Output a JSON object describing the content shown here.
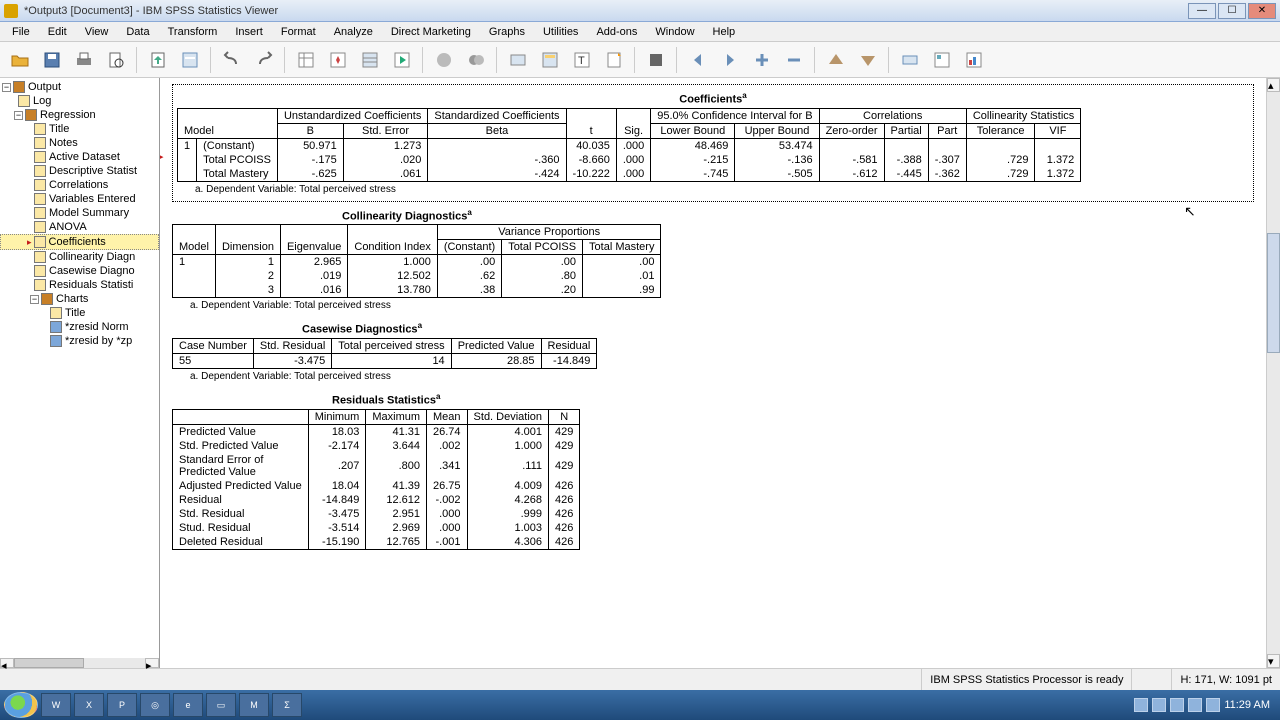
{
  "window": {
    "title": "*Output3 [Document3] - IBM SPSS Statistics Viewer"
  },
  "menu": [
    "File",
    "Edit",
    "View",
    "Data",
    "Transform",
    "Insert",
    "Format",
    "Analyze",
    "Direct Marketing",
    "Graphs",
    "Utilities",
    "Add-ons",
    "Window",
    "Help"
  ],
  "outline": {
    "root": "Output",
    "log": "Log",
    "regression": "Regression",
    "items": [
      "Title",
      "Notes",
      "Active Dataset",
      "Descriptive Statist",
      "Correlations",
      "Variables Entered",
      "Model Summary",
      "ANOVA",
      "Coefficients",
      "Collinearity Diagn",
      "Casewise Diagno",
      "Residuals Statisti"
    ],
    "selected_index": 8,
    "charts": "Charts",
    "chart_items": [
      "Title",
      "*zresid Norm",
      "*zresid by *zp"
    ]
  },
  "tables": {
    "coefficients": {
      "title": "Coefficients",
      "group_headers": [
        "Unstandardized Coefficients",
        "Standardized Coefficients",
        "",
        "",
        "95.0% Confidence Interval for B",
        "Correlations",
        "Collinearity Statistics"
      ],
      "cols": [
        "Model",
        "",
        "B",
        "Std. Error",
        "Beta",
        "t",
        "Sig.",
        "Lower Bound",
        "Upper Bound",
        "Zero-order",
        "Partial",
        "Part",
        "Tolerance",
        "VIF"
      ],
      "rows": [
        [
          "1",
          "(Constant)",
          "50.971",
          "1.273",
          "",
          "40.035",
          ".000",
          "48.469",
          "53.474",
          "",
          "",
          "",
          "",
          ""
        ],
        [
          "",
          "Total PCOISS",
          "-.175",
          ".020",
          "-.360",
          "-8.660",
          ".000",
          "-.215",
          "-.136",
          "-.581",
          "-.388",
          "-.307",
          ".729",
          "1.372"
        ],
        [
          "",
          "Total Mastery",
          "-.625",
          ".061",
          "-.424",
          "-10.222",
          ".000",
          "-.745",
          "-.505",
          "-.612",
          "-.445",
          "-.362",
          ".729",
          "1.372"
        ]
      ],
      "footnote": "a. Dependent Variable: Total perceived stress"
    },
    "collinearity": {
      "title": "Collinearity Diagnostics",
      "group_header": "Variance Proportions",
      "cols": [
        "Model",
        "Dimension",
        "Eigenvalue",
        "Condition Index",
        "(Constant)",
        "Total PCOISS",
        "Total Mastery"
      ],
      "rows": [
        [
          "1",
          "1",
          "2.965",
          "1.000",
          ".00",
          ".00",
          ".00"
        ],
        [
          "",
          "2",
          ".019",
          "12.502",
          ".62",
          ".80",
          ".01"
        ],
        [
          "",
          "3",
          ".016",
          "13.780",
          ".38",
          ".20",
          ".99"
        ]
      ],
      "footnote": "a. Dependent Variable: Total perceived stress"
    },
    "casewise": {
      "title": "Casewise Diagnostics",
      "cols": [
        "Case Number",
        "Std. Residual",
        "Total perceived stress",
        "Predicted Value",
        "Residual"
      ],
      "rows": [
        [
          "55",
          "-3.475",
          "14",
          "28.85",
          "-14.849"
        ]
      ],
      "footnote": "a. Dependent Variable: Total perceived stress"
    },
    "residuals": {
      "title": "Residuals Statistics",
      "cols": [
        "",
        "Minimum",
        "Maximum",
        "Mean",
        "Std. Deviation",
        "N"
      ],
      "rows": [
        [
          "Predicted Value",
          "18.03",
          "41.31",
          "26.74",
          "4.001",
          "429"
        ],
        [
          "Std. Predicted Value",
          "-2.174",
          "3.644",
          ".002",
          "1.000",
          "429"
        ],
        [
          "Standard Error of Predicted Value",
          ".207",
          ".800",
          ".341",
          ".111",
          "429"
        ],
        [
          "Adjusted Predicted Value",
          "18.04",
          "41.39",
          "26.75",
          "4.009",
          "426"
        ],
        [
          "Residual",
          "-14.849",
          "12.612",
          "-.002",
          "4.268",
          "426"
        ],
        [
          "Std. Residual",
          "-3.475",
          "2.951",
          ".000",
          ".999",
          "426"
        ],
        [
          "Stud. Residual",
          "-3.514",
          "2.969",
          ".000",
          "1.003",
          "426"
        ],
        [
          "Deleted Residual",
          "-15.190",
          "12.765",
          "-.001",
          "4.306",
          "426"
        ]
      ]
    }
  },
  "status": {
    "processor": "IBM SPSS Statistics Processor is ready",
    "pos": "H: 171, W: 1091 pt"
  },
  "taskbar": {
    "time": "11:29 AM"
  }
}
